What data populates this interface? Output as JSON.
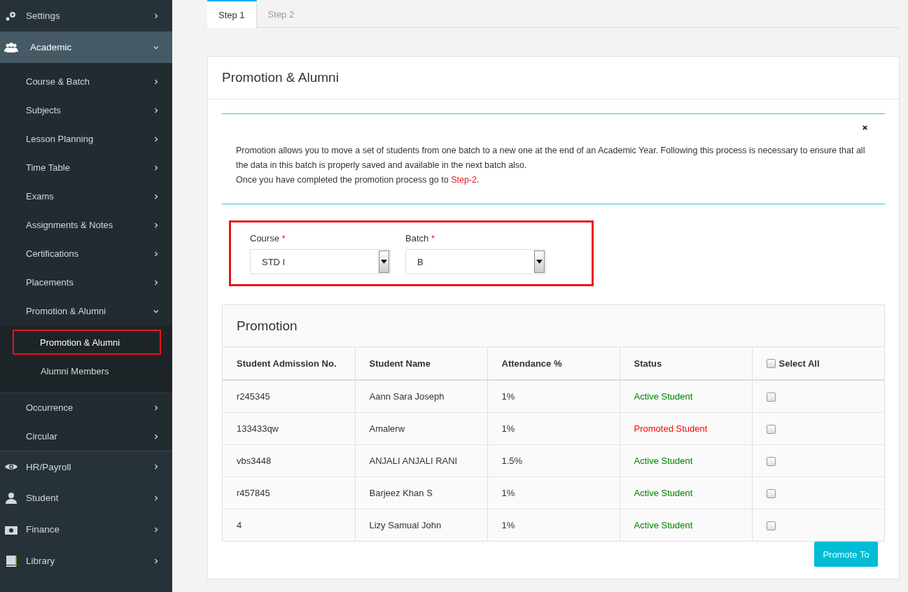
{
  "sidebar": {
    "items": [
      {
        "label": "Settings",
        "expanded": false,
        "selected": false
      },
      {
        "label": "Academic",
        "expanded": true,
        "selected": true,
        "children": [
          {
            "label": "Course & Batch",
            "expanded": false
          },
          {
            "label": "Subjects",
            "expanded": false
          },
          {
            "label": "Lesson Planning",
            "expanded": false
          },
          {
            "label": "Time Table",
            "expanded": false
          },
          {
            "label": "Exams",
            "expanded": false
          },
          {
            "label": "Assignments & Notes",
            "expanded": false
          },
          {
            "label": "Certifications",
            "expanded": false
          },
          {
            "label": "Placements",
            "expanded": false
          },
          {
            "label": "Promotion & Alumni",
            "expanded": true,
            "children": [
              {
                "label": "Promotion & Alumni",
                "selected": true
              },
              {
                "label": "Alumni Members",
                "selected": false
              }
            ]
          },
          {
            "label": "Occurrence",
            "expanded": false
          },
          {
            "label": "Circular",
            "expanded": false
          }
        ]
      },
      {
        "label": "HR/Payroll",
        "expanded": false,
        "selected": false
      },
      {
        "label": "Student",
        "expanded": false,
        "selected": false
      },
      {
        "label": "Finance",
        "expanded": false,
        "selected": false
      },
      {
        "label": "Library",
        "expanded": false,
        "selected": false
      }
    ]
  },
  "tabs": [
    {
      "label": "Step 1",
      "selected": true
    },
    {
      "label": "Step 2",
      "selected": false
    }
  ],
  "card": {
    "title": "Promotion & Alumni",
    "alert": {
      "paragraphs": [
        "Promotion allows you to move a set of students from one batch to a new one at the end of an Academic Year. Following this process is necessary to ensure that all the data in this batch is properly saved and available in the next batch also."
      ],
      "last_line": "Once you have completed the promotion process go to ",
      "link": "Step-2",
      "end": "."
    },
    "filters": [
      {
        "label": "Course",
        "required_mark": "*",
        "value": "STD I"
      },
      {
        "label": "Batch",
        "required_mark": "*",
        "value": "B"
      }
    ],
    "promotion": {
      "title": "Promotion",
      "columns": [
        "Student Admission No.",
        "Student Name",
        "Attendance %",
        "Status"
      ],
      "select_all": {
        "label": "Select All",
        "checked": false
      },
      "rows": [
        {
          "admission_no": "r245345",
          "name": "Aann Sara Joseph",
          "attendance": "1%",
          "status": "Active Student",
          "color": "#008000",
          "checked": false
        },
        {
          "admission_no": "133433qw",
          "name": "Amalerw",
          "attendance": "1%",
          "status": "Promoted Student",
          "color": "#ff0000",
          "checked": false
        },
        {
          "admission_no": "vbs3448",
          "name": "ANJALI ANJALI RANI",
          "attendance": "1.5%",
          "status": "Active Student",
          "color": "#008000",
          "checked": false
        },
        {
          "admission_no": "r457845",
          "name": "Barjeez Khan S",
          "attendance": "1%",
          "status": "Active Student",
          "color": "#008000",
          "checked": false
        },
        {
          "admission_no": "4",
          "name": "Lizy Samual John",
          "attendance": "1%",
          "status": "Active Student",
          "color": "#008000",
          "checked": false
        }
      ]
    },
    "button": "Promote To"
  }
}
